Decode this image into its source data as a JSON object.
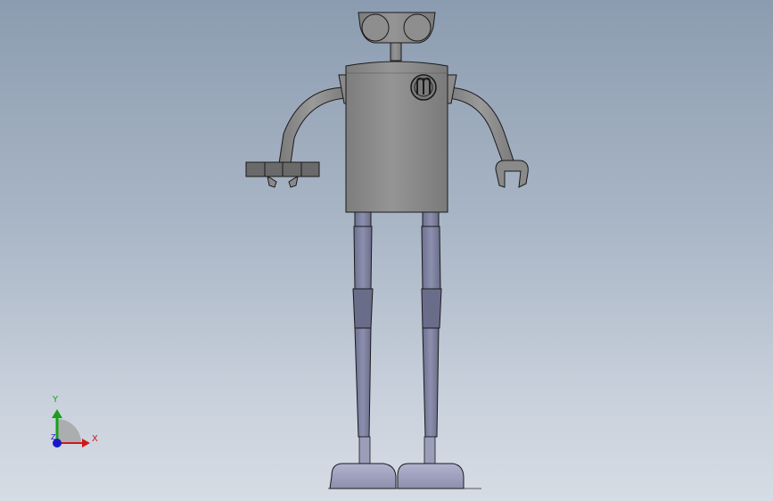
{
  "viewport": {
    "background_top": "#8c9cb0",
    "background_bottom": "#d6dce4"
  },
  "model": {
    "part_color": "#8a8a8a",
    "leg_color": "#7e82a0",
    "foot_color": "#a0a4c0",
    "edge_color": "#1a1a1a",
    "emblem_letter": "m"
  },
  "triad": {
    "x_label": "X",
    "y_label": "Y",
    "z_label": "Z",
    "x_color": "#d01818",
    "y_color": "#18a018",
    "z_color": "#1818c8"
  }
}
